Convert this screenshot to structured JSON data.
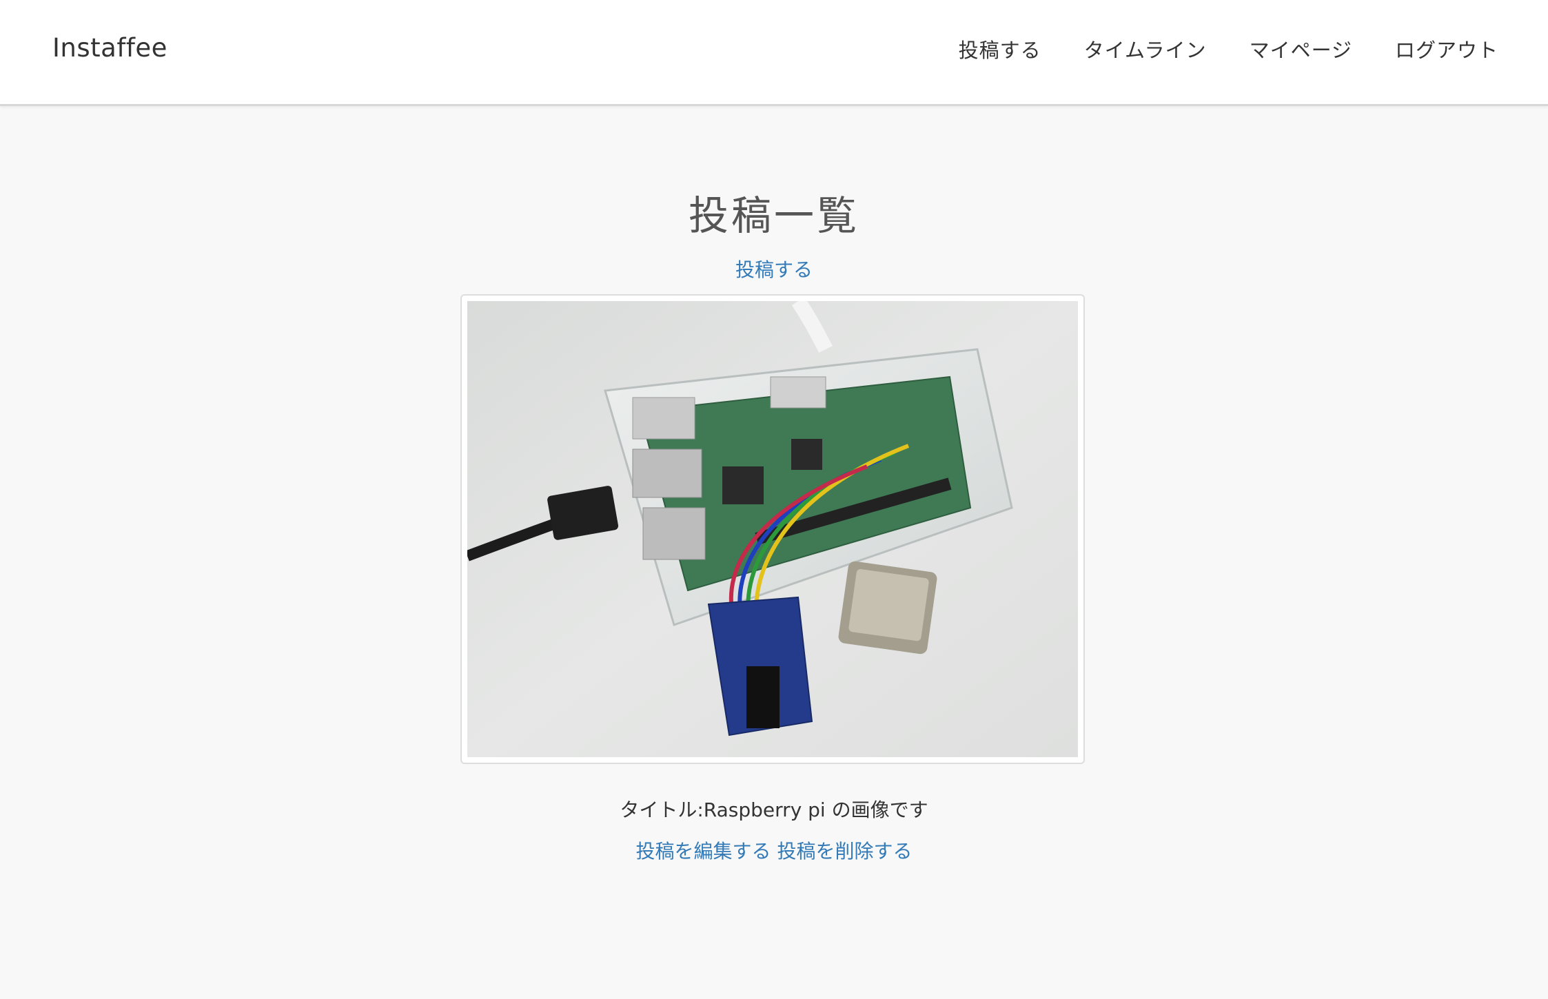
{
  "navbar": {
    "brand": "Instaffee",
    "items": [
      {
        "label": "投稿する"
      },
      {
        "label": "タイムライン"
      },
      {
        "label": "マイページ"
      },
      {
        "label": "ログアウト"
      }
    ]
  },
  "main": {
    "title": "投稿一覧",
    "new_post_link": "投稿する",
    "post": {
      "image_alt": "Raspberry pi photo",
      "title_label": "タイトル:",
      "title": "Raspberry pi の画像です",
      "edit_link": "投稿を編集する",
      "delete_link": "投稿を削除する"
    }
  },
  "colors": {
    "link": "#337ab7",
    "page_bg": "#f8f8f8",
    "navbar_bg": "#ffffff"
  }
}
